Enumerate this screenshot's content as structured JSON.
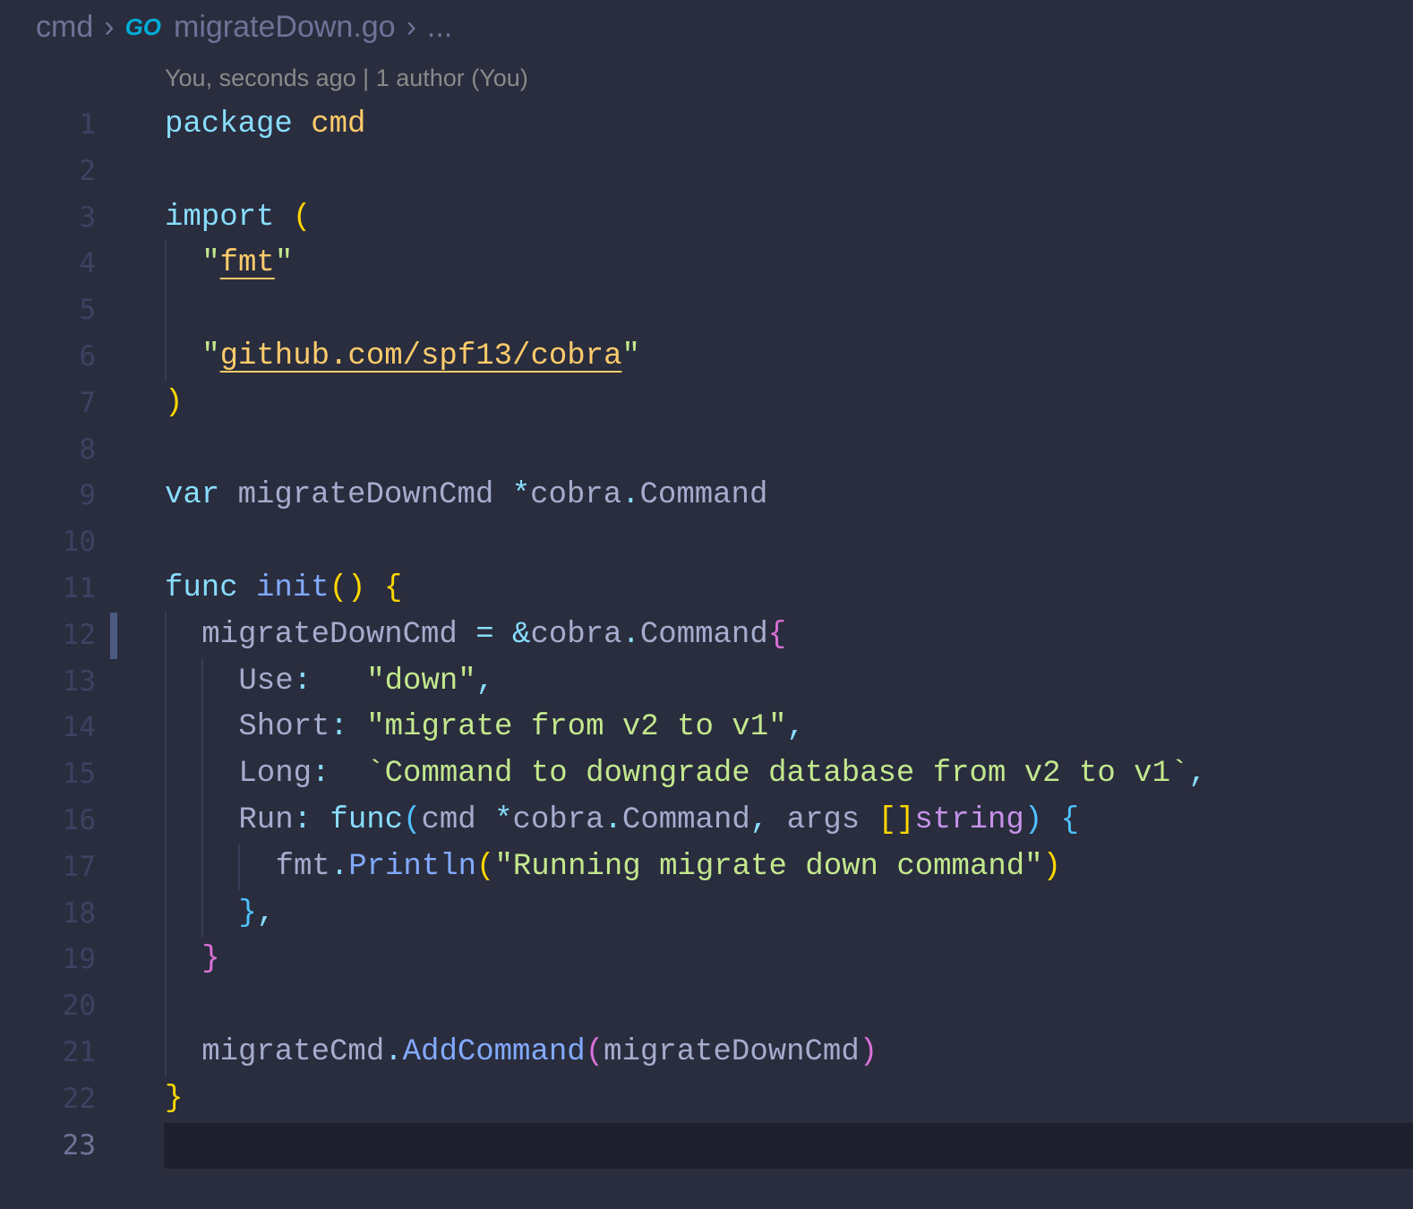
{
  "breadcrumb": {
    "folder": "cmd",
    "go_icon": "GO",
    "file": "migrateDown.go",
    "more": "..."
  },
  "blame": "You, seconds ago | 1 author (You)",
  "current_line": 23,
  "modified_line": 12,
  "lines": [
    {
      "n": "1",
      "indent": 0,
      "tokens": [
        {
          "t": "package ",
          "c": "kw"
        },
        {
          "t": "cmd",
          "c": "pkg"
        }
      ]
    },
    {
      "n": "2",
      "indent": 0,
      "tokens": []
    },
    {
      "n": "3",
      "indent": 0,
      "tokens": [
        {
          "t": "import ",
          "c": "kw"
        },
        {
          "t": "(",
          "c": "b1"
        }
      ]
    },
    {
      "n": "4",
      "indent": 1,
      "tokens": [
        {
          "t": "\"",
          "c": "str"
        },
        {
          "t": "fmt",
          "c": "link"
        },
        {
          "t": "\"",
          "c": "str"
        }
      ]
    },
    {
      "n": "5",
      "indent": 1,
      "tokens": []
    },
    {
      "n": "6",
      "indent": 1,
      "tokens": [
        {
          "t": "\"",
          "c": "str"
        },
        {
          "t": "github.com/spf13/cobra",
          "c": "link"
        },
        {
          "t": "\"",
          "c": "str"
        }
      ]
    },
    {
      "n": "7",
      "indent": 0,
      "tokens": [
        {
          "t": ")",
          "c": "b1"
        }
      ]
    },
    {
      "n": "8",
      "indent": 0,
      "tokens": []
    },
    {
      "n": "9",
      "indent": 0,
      "tokens": [
        {
          "t": "var ",
          "c": "kw"
        },
        {
          "t": "migrateDownCmd ",
          "c": "plain"
        },
        {
          "t": "*",
          "c": "op"
        },
        {
          "t": "cobra",
          "c": "plain"
        },
        {
          "t": ".",
          "c": "op"
        },
        {
          "t": "Command",
          "c": "plain"
        }
      ]
    },
    {
      "n": "10",
      "indent": 0,
      "tokens": []
    },
    {
      "n": "11",
      "indent": 0,
      "tokens": [
        {
          "t": "func ",
          "c": "kw"
        },
        {
          "t": "init",
          "c": "fn"
        },
        {
          "t": "() {",
          "c": "b1"
        }
      ]
    },
    {
      "n": "12",
      "indent": 1,
      "tokens": [
        {
          "t": "migrateDownCmd ",
          "c": "plain"
        },
        {
          "t": "= &",
          "c": "op"
        },
        {
          "t": "cobra",
          "c": "plain"
        },
        {
          "t": ".",
          "c": "op"
        },
        {
          "t": "Command",
          "c": "plain"
        },
        {
          "t": "{",
          "c": "b2"
        }
      ]
    },
    {
      "n": "13",
      "indent": 2,
      "tokens": [
        {
          "t": "Use",
          "c": "plain"
        },
        {
          "t": ":   ",
          "c": "op"
        },
        {
          "t": "\"down\"",
          "c": "str"
        },
        {
          "t": ",",
          "c": "op"
        }
      ]
    },
    {
      "n": "14",
      "indent": 2,
      "tokens": [
        {
          "t": "Short",
          "c": "plain"
        },
        {
          "t": ": ",
          "c": "op"
        },
        {
          "t": "\"migrate from v2 to v1\"",
          "c": "str"
        },
        {
          "t": ",",
          "c": "op"
        }
      ]
    },
    {
      "n": "15",
      "indent": 2,
      "tokens": [
        {
          "t": "Long",
          "c": "plain"
        },
        {
          "t": ":  ",
          "c": "op"
        },
        {
          "t": "`Command to downgrade database from v2 to v1`",
          "c": "str"
        },
        {
          "t": ",",
          "c": "op"
        }
      ]
    },
    {
      "n": "16",
      "indent": 2,
      "tokens": [
        {
          "t": "Run",
          "c": "plain"
        },
        {
          "t": ": ",
          "c": "op"
        },
        {
          "t": "func",
          "c": "kw"
        },
        {
          "t": "(",
          "c": "b3"
        },
        {
          "t": "cmd ",
          "c": "plain"
        },
        {
          "t": "*",
          "c": "op"
        },
        {
          "t": "cobra",
          "c": "plain"
        },
        {
          "t": ".",
          "c": "op"
        },
        {
          "t": "Command",
          "c": "plain"
        },
        {
          "t": ", ",
          "c": "op"
        },
        {
          "t": "args ",
          "c": "plain"
        },
        {
          "t": "[]",
          "c": "b1"
        },
        {
          "t": "string",
          "c": "typ"
        },
        {
          "t": ") {",
          "c": "b3"
        }
      ]
    },
    {
      "n": "17",
      "indent": 3,
      "tokens": [
        {
          "t": "fmt",
          "c": "plain"
        },
        {
          "t": ".",
          "c": "op"
        },
        {
          "t": "Println",
          "c": "fn"
        },
        {
          "t": "(",
          "c": "b1"
        },
        {
          "t": "\"Running migrate down command\"",
          "c": "str"
        },
        {
          "t": ")",
          "c": "b1"
        }
      ]
    },
    {
      "n": "18",
      "indent": 2,
      "tokens": [
        {
          "t": "}",
          "c": "b3"
        },
        {
          "t": ",",
          "c": "op"
        }
      ]
    },
    {
      "n": "19",
      "indent": 1,
      "tokens": [
        {
          "t": "}",
          "c": "b2"
        }
      ]
    },
    {
      "n": "20",
      "indent": 1,
      "tokens": []
    },
    {
      "n": "21",
      "indent": 1,
      "tokens": [
        {
          "t": "migrateCmd",
          "c": "plain"
        },
        {
          "t": ".",
          "c": "op"
        },
        {
          "t": "AddCommand",
          "c": "fn"
        },
        {
          "t": "(",
          "c": "b2"
        },
        {
          "t": "migrateDownCmd",
          "c": "plain"
        },
        {
          "t": ")",
          "c": "b2"
        }
      ]
    },
    {
      "n": "22",
      "indent": 0,
      "tokens": [
        {
          "t": "}",
          "c": "b1"
        }
      ]
    },
    {
      "n": "23",
      "indent": 0,
      "tokens": []
    }
  ]
}
